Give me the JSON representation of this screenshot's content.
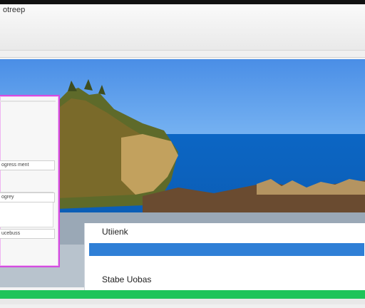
{
  "window": {
    "title": "otreep"
  },
  "side_panel": {
    "row1": "ogress ment",
    "row2": "ogrey",
    "row3": "ucebuss"
  },
  "card": {
    "label": "Utiienk",
    "subtitle": "Stabe Uobas"
  },
  "progress": {
    "value": 100
  },
  "colors": {
    "accent_blue": "#2f7fd6",
    "progress_green": "#1ec45a",
    "panel_outline": "#d44ce0"
  }
}
